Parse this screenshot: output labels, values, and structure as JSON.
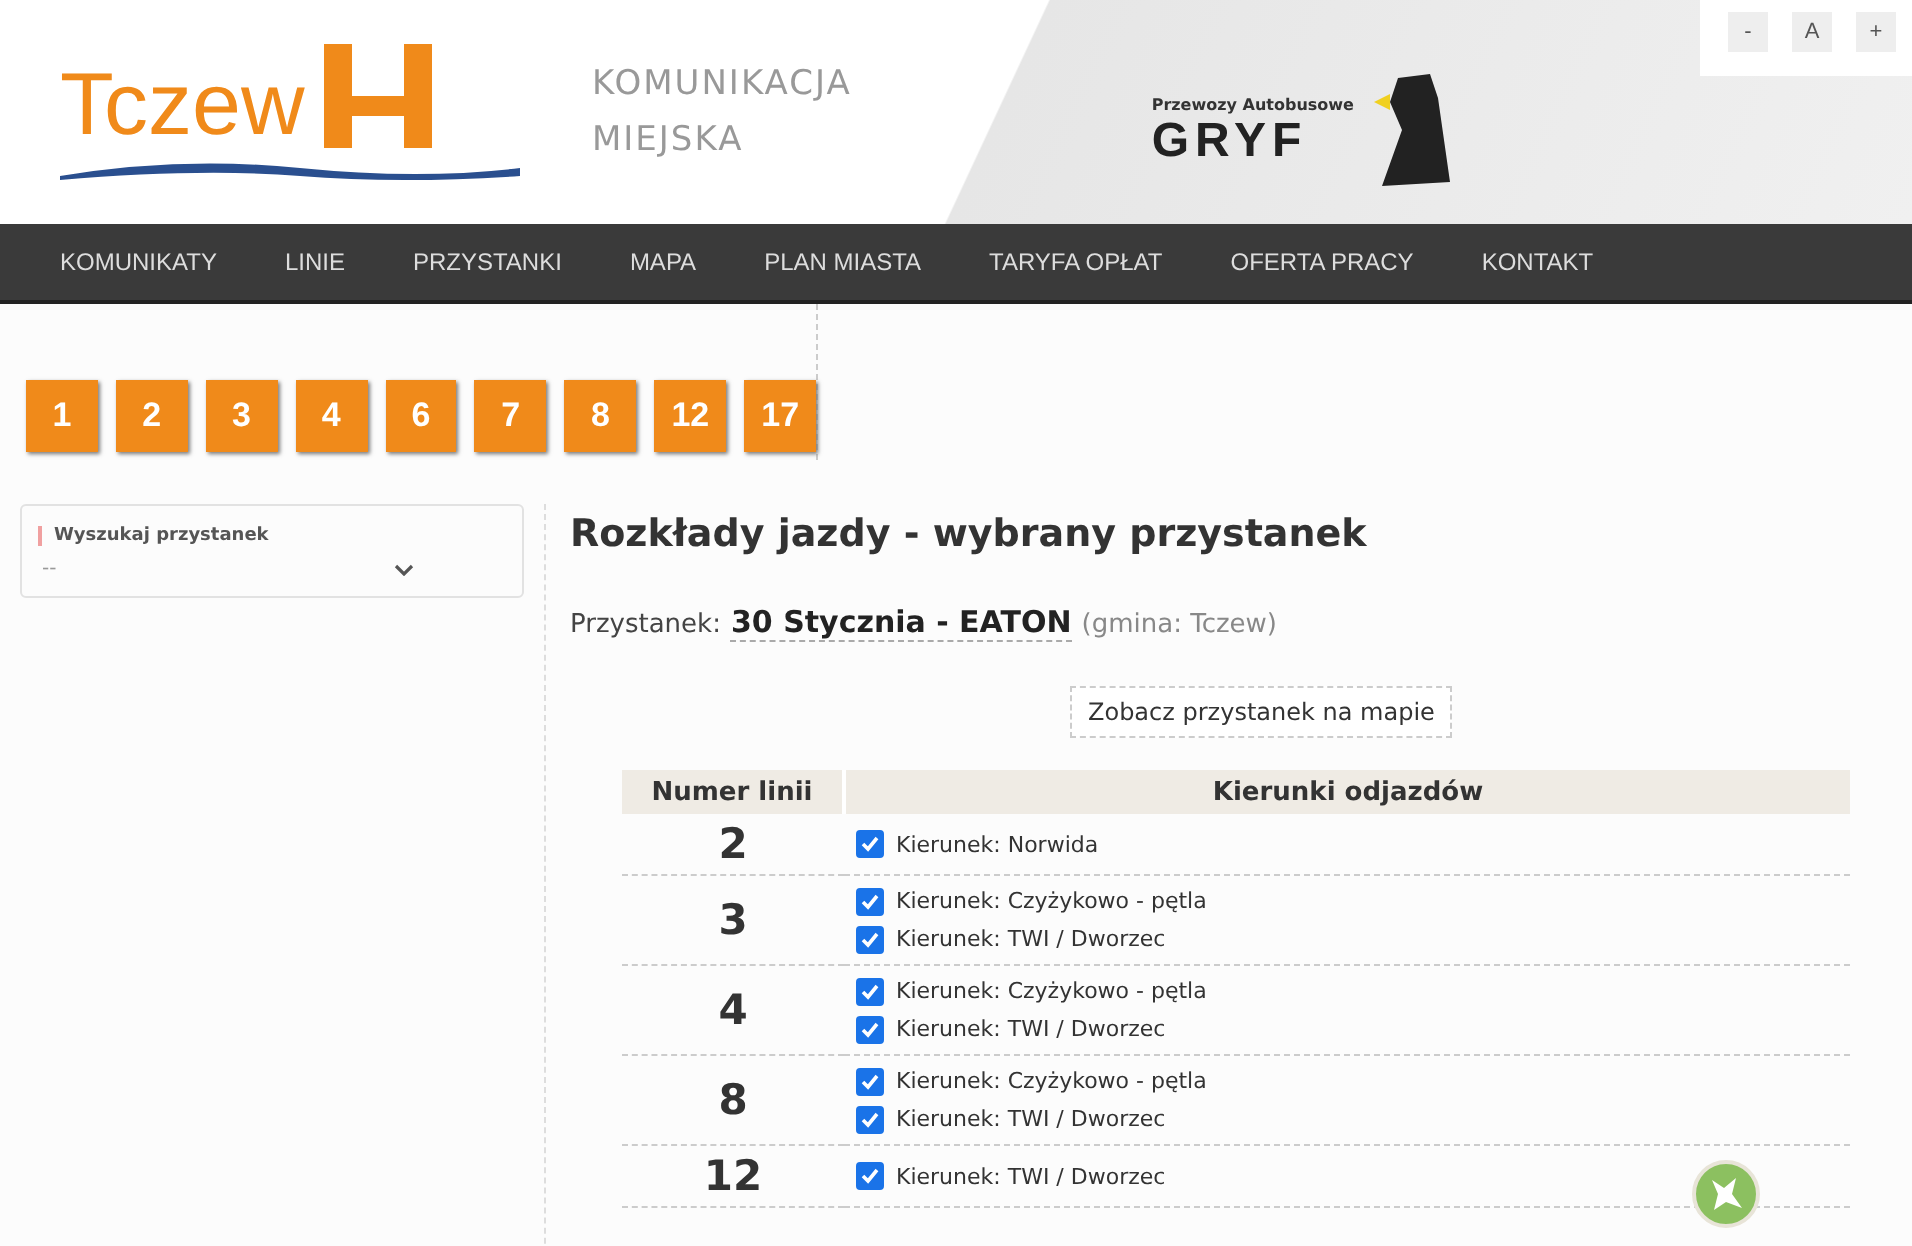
{
  "header": {
    "logo_text": "Tczew",
    "subtitle_lines": [
      "KOMUNIKACJA",
      "MIEJSKA"
    ],
    "operator_caption": "Przewozy Autobusowe",
    "operator_name": "GRYF"
  },
  "font_controls": [
    "-",
    "A",
    "+"
  ],
  "nav": [
    "KOMUNIKATY",
    "LINIE",
    "PRZYSTANKI",
    "MAPA",
    "PLAN MIASTA",
    "TARYFA OPŁAT",
    "OFERTA PRACY",
    "KONTAKT"
  ],
  "line_buttons": [
    "1",
    "2",
    "3",
    "4",
    "6",
    "7",
    "8",
    "12",
    "17"
  ],
  "sidebar": {
    "search_label": "Wyszukaj przystanek",
    "select_value": "--"
  },
  "main": {
    "title": "Rozkłady jazdy - wybrany przystanek",
    "stop_label": "Przystanek:",
    "stop_name": "30 Stycznia - EATON",
    "stop_gmina": "(gmina: Tczew)",
    "map_button": "Zobacz przystanek na mapie",
    "table": {
      "columns": [
        "Numer linii",
        "Kierunki odjazdów"
      ],
      "rows": [
        {
          "line": "2",
          "directions": [
            {
              "label": "Kierunek: Norwida",
              "checked": true
            }
          ]
        },
        {
          "line": "3",
          "directions": [
            {
              "label": "Kierunek: Czyżykowo - pętla",
              "checked": true
            },
            {
              "label": "Kierunek: TWI / Dworzec",
              "checked": true
            }
          ]
        },
        {
          "line": "4",
          "directions": [
            {
              "label": "Kierunek: Czyżykowo - pętla",
              "checked": true
            },
            {
              "label": "Kierunek: TWI / Dworzec",
              "checked": true
            }
          ]
        },
        {
          "line": "8",
          "directions": [
            {
              "label": "Kierunek: Czyżykowo - pętla",
              "checked": true
            },
            {
              "label": "Kierunek: TWI / Dworzec",
              "checked": true
            }
          ]
        },
        {
          "line": "12",
          "directions": [
            {
              "label": "Kierunek: TWI / Dworzec",
              "checked": true
            }
          ]
        }
      ]
    }
  }
}
